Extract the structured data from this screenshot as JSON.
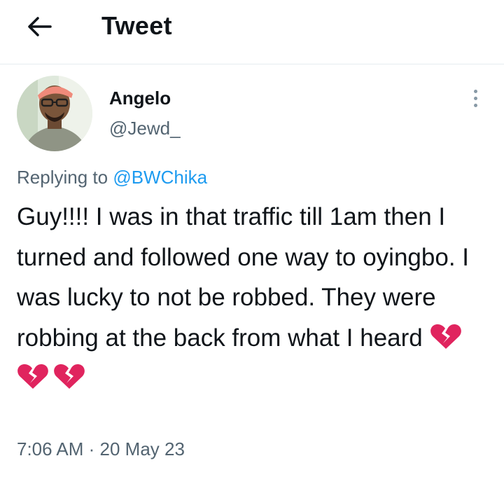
{
  "header": {
    "title": "Tweet",
    "back_icon": "arrow-left-icon"
  },
  "author": {
    "name": "Angelo",
    "handle": "@Jewd_"
  },
  "reply": {
    "prefix": "Replying to ",
    "mention": "@BWChika"
  },
  "tweet": {
    "text": "Guy!!!! I was in that traffic till 1am then I turned and followed one way to oyingbo. I was lucky to not be robbed. They were robbing at the back from what I heard ",
    "emojis": [
      "broken-heart-icon",
      "broken-heart-icon",
      "broken-heart-icon"
    ]
  },
  "meta": {
    "time": "7:06 AM",
    "separator": " · ",
    "date": "20 May 23"
  },
  "colors": {
    "accent": "#1d9bf0",
    "heart": "#e0245e",
    "secondary_text": "#536471"
  }
}
